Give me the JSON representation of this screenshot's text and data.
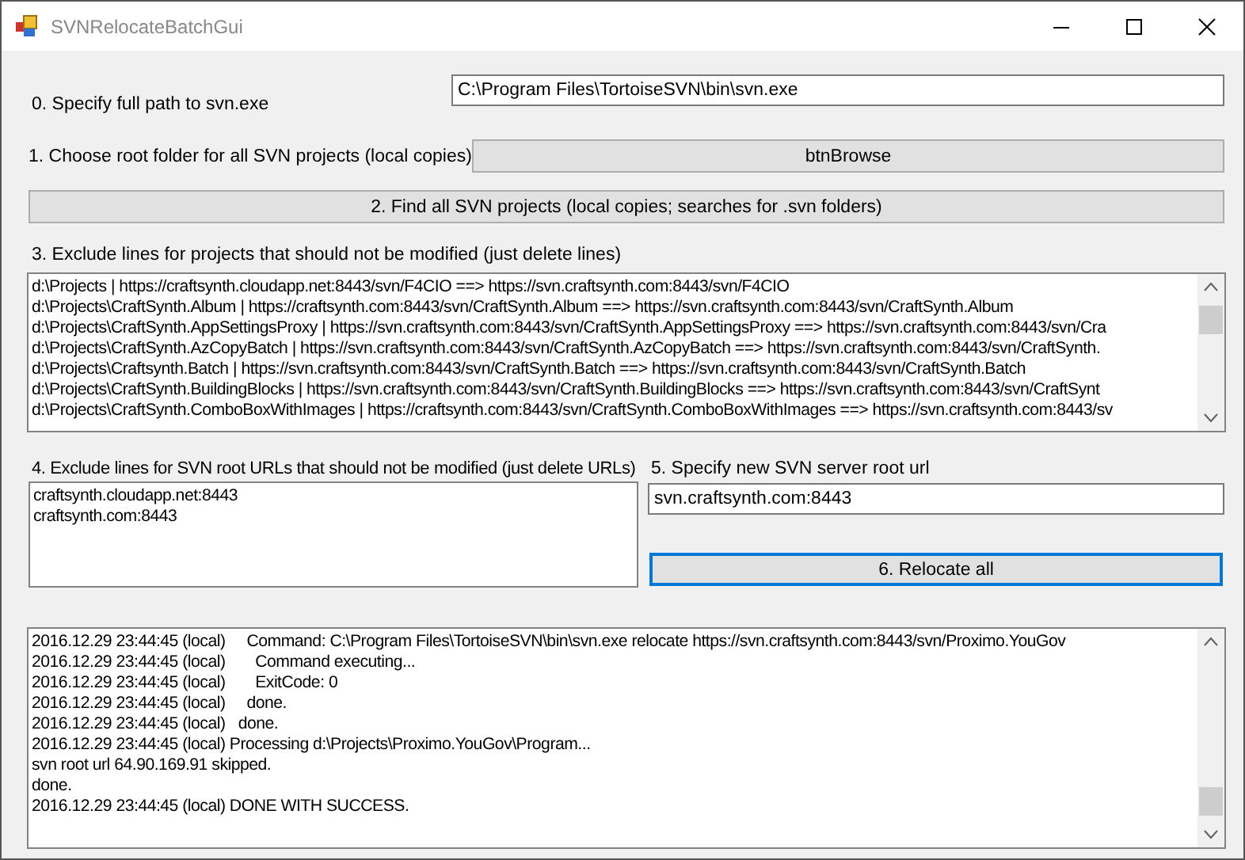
{
  "window": {
    "title": "SVNRelocateBatchGui"
  },
  "svn_path": {
    "label": "0. Specify full path to svn.exe",
    "value": "C:\\Program Files\\TortoiseSVN\\bin\\svn.exe"
  },
  "root_folder": {
    "label": "1. Choose root folder for all SVN projects (local copies)",
    "button": "btnBrowse"
  },
  "find_button": "2. Find all SVN projects (local copies; searches for .svn folders)",
  "projects": {
    "label": "3. Exclude lines for projects that should not be modified (just delete lines)",
    "lines": [
      "d:\\Projects | https://craftsynth.cloudapp.net:8443/svn/F4CIO ==> https://svn.craftsynth.com:8443/svn/F4CIO",
      "d:\\Projects\\CraftSynth.Album | https://craftsynth.com:8443/svn/CraftSynth.Album ==> https://svn.craftsynth.com:8443/svn/CraftSynth.Album",
      "d:\\Projects\\CraftSynth.AppSettingsProxy | https://svn.craftsynth.com:8443/svn/CraftSynth.AppSettingsProxy ==> https://svn.craftsynth.com:8443/svn/Cra",
      "d:\\Projects\\CraftSynth.AzCopyBatch | https://svn.craftsynth.com:8443/svn/CraftSynth.AzCopyBatch ==> https://svn.craftsynth.com:8443/svn/CraftSynth.",
      "d:\\Projects\\Craftsynth.Batch | https://svn.craftsynth.com:8443/svn/CraftSynth.Batch ==> https://svn.craftsynth.com:8443/svn/CraftSynth.Batch",
      "d:\\Projects\\CraftSynth.BuildingBlocks | https://svn.craftsynth.com:8443/svn/CraftSynth.BuildingBlocks ==> https://svn.craftsynth.com:8443/svn/CraftSynt",
      "d:\\Projects\\CraftSynth.ComboBoxWithImages | https://craftsynth.com:8443/svn/CraftSynth.ComboBoxWithImages ==> https://svn.craftsynth.com:8443/sv"
    ]
  },
  "root_urls": {
    "label": "4. Exclude lines for SVN root URLs that should not be modified (just delete URLs)",
    "lines": [
      "craftsynth.cloudapp.net:8443",
      "craftsynth.com:8443"
    ]
  },
  "new_url": {
    "label": "5. Specify new SVN server root url",
    "value": "svn.craftsynth.com:8443"
  },
  "relocate_button": {
    "label": "6. Relocate all",
    "focused": true
  },
  "log": {
    "lines": [
      "2016.12.29 23:44:45 (local)     Command: C:\\Program Files\\TortoiseSVN\\bin\\svn.exe relocate https://svn.craftsynth.com:8443/svn/Proximo.YouGov",
      "2016.12.29 23:44:45 (local)       Command executing...",
      "2016.12.29 23:44:45 (local)       ExitCode: 0",
      "2016.12.29 23:44:45 (local)     done.",
      "2016.12.29 23:44:45 (local)   done.",
      "2016.12.29 23:44:45 (local) Processing d:\\Projects\\Proximo.YouGov\\Program...",
      "svn root url 64.90.169.91 skipped.",
      "done.",
      "2016.12.29 23:44:45 (local) DONE WITH SUCCESS."
    ]
  }
}
